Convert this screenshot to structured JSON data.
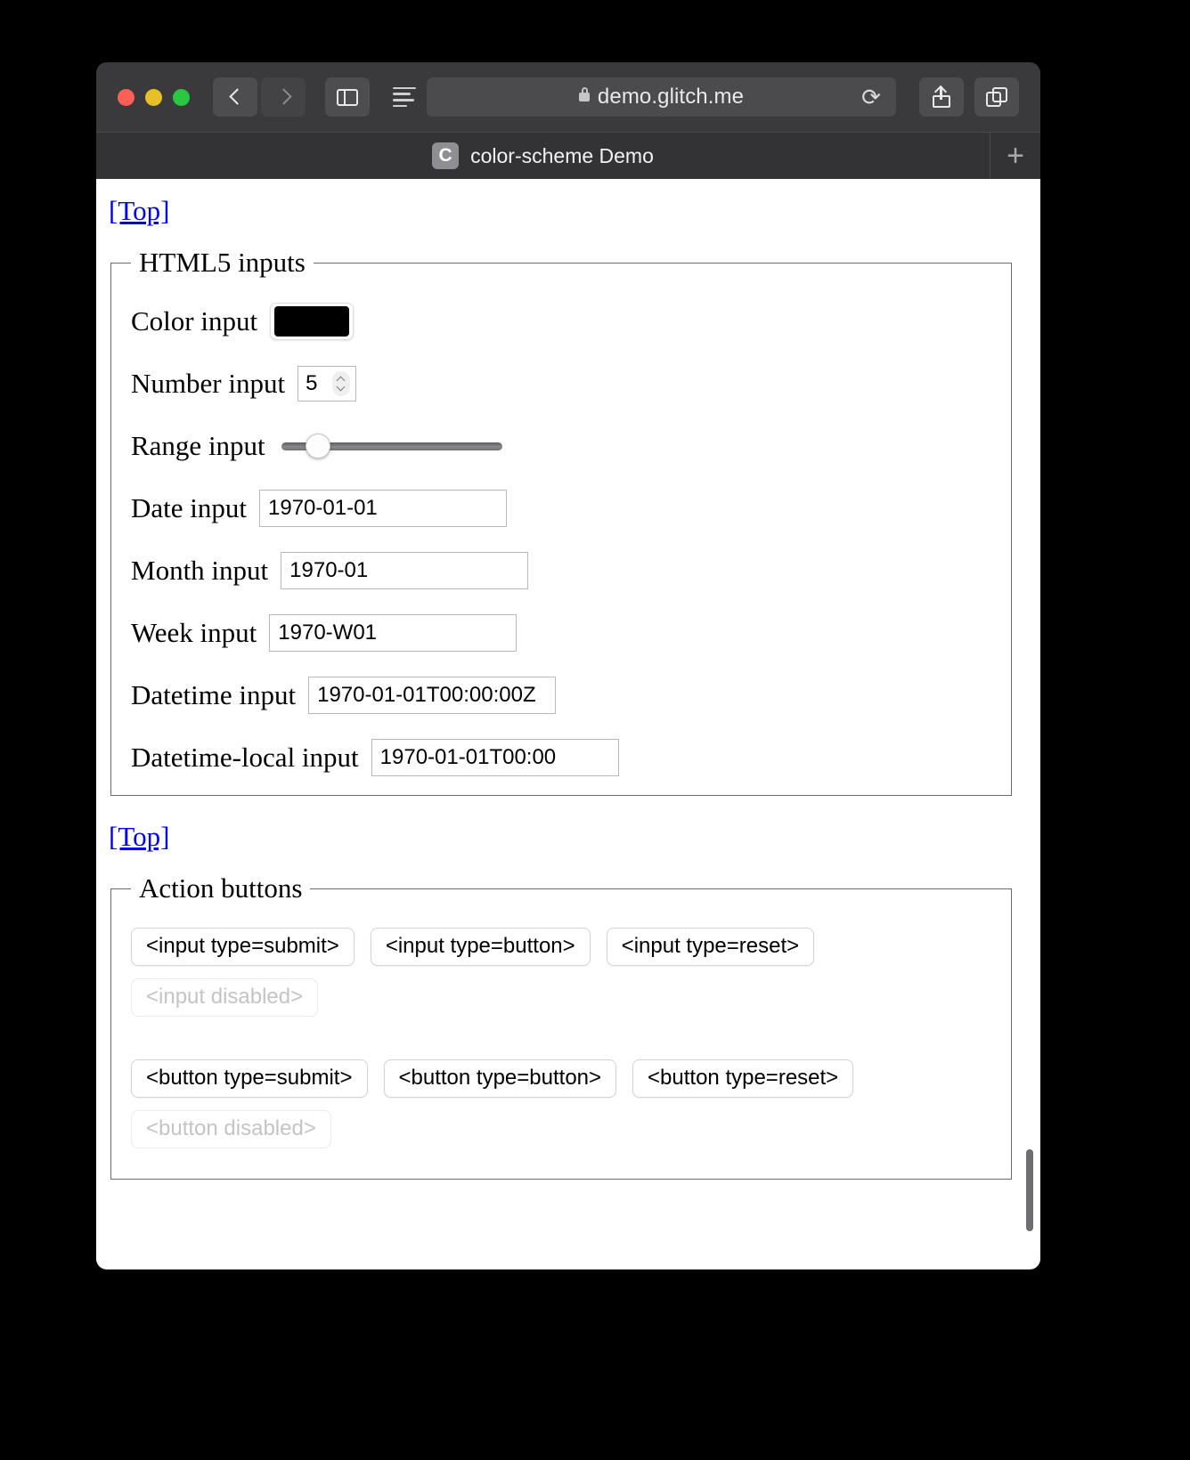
{
  "browser": {
    "url": "demo.glitch.me",
    "lock_icon": "lock-icon",
    "reload_icon": "reload-icon",
    "back_icon": "chevron-left-icon",
    "forward_icon": "chevron-right-icon",
    "sidebar_icon": "sidebar-icon",
    "reader_icon": "reader-menu-icon",
    "share_icon": "share-icon",
    "tabs_icon": "tab-overview-icon",
    "new_tab_label": "+",
    "tab": {
      "favicon_letter": "C",
      "title": "color-scheme Demo"
    },
    "traffic_lights": [
      "close",
      "minimize",
      "maximize"
    ]
  },
  "page": {
    "top_link_1": "[Top]",
    "top_link_2": "[Top]",
    "fieldsets": {
      "html5_inputs": {
        "legend": "HTML5 inputs",
        "rows": [
          {
            "label": "Color input",
            "type": "color",
            "value": "#000000"
          },
          {
            "label": "Number input",
            "type": "number",
            "value": "5"
          },
          {
            "label": "Range input",
            "type": "range",
            "value": "11"
          },
          {
            "label": "Date input",
            "type": "text",
            "value": "1970-01-01"
          },
          {
            "label": "Month input",
            "type": "text",
            "value": "1970-01"
          },
          {
            "label": "Week input",
            "type": "text",
            "value": "1970-W01"
          },
          {
            "label": "Datetime input",
            "type": "text",
            "value": "1970-01-01T00:00:00Z"
          },
          {
            "label": "Datetime-local input",
            "type": "text",
            "value": "1970-01-01T00:00"
          }
        ]
      },
      "action_buttons": {
        "legend": "Action buttons",
        "input_row": [
          "<input type=submit>",
          "<input type=button>",
          "<input type=reset>"
        ],
        "input_disabled": "<input disabled>",
        "button_row": [
          "<button type=submit>",
          "<button type=button>",
          "<button type=reset>"
        ],
        "button_disabled": "<button disabled>"
      }
    }
  },
  "colors": {
    "link": "#0000ee",
    "color_swatch": "#000000",
    "chrome_bg": "#3a3a3c",
    "page_bg": "#ffffff"
  }
}
